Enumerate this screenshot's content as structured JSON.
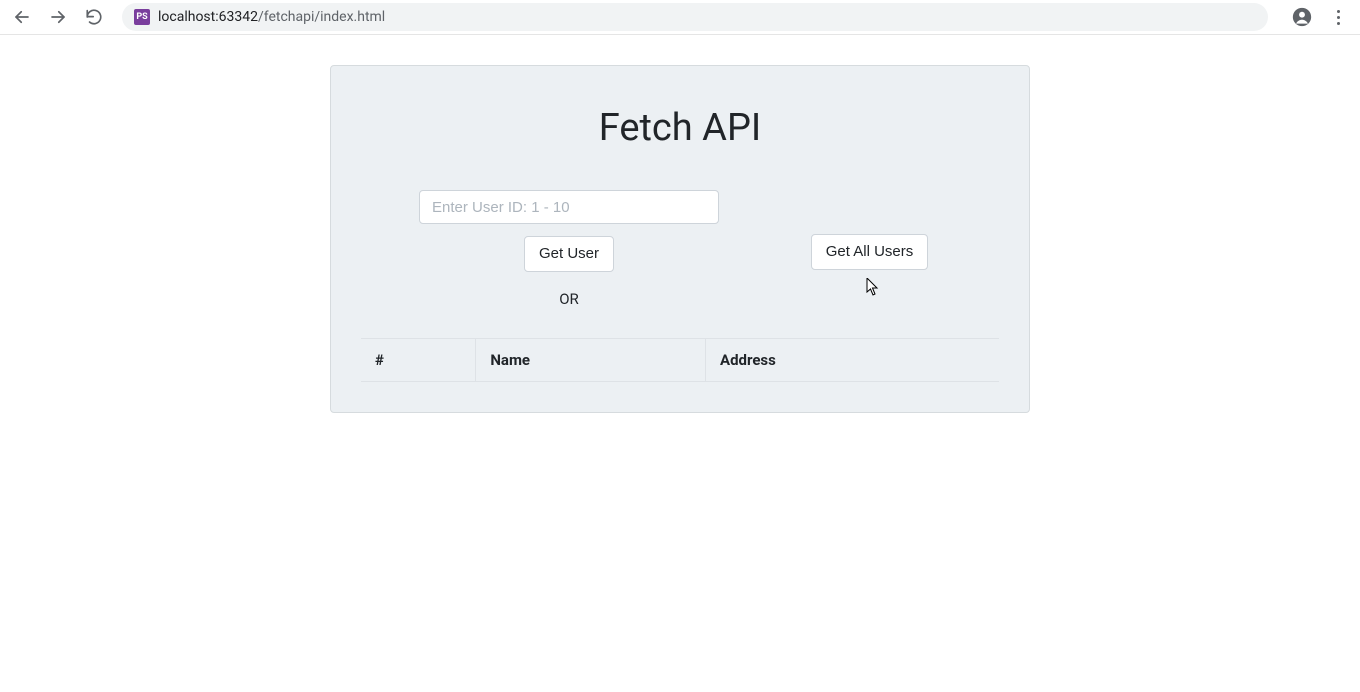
{
  "browser": {
    "url_host": "localhost:63342",
    "url_path": "/fetchapi/index.html",
    "favicon_text": "PS"
  },
  "page": {
    "title": "Fetch API",
    "input_placeholder": "Enter User ID: 1 - 10",
    "input_value": "",
    "get_user_label": "Get User",
    "or_label": "OR",
    "get_all_users_label": "Get All Users"
  },
  "table": {
    "headers": {
      "id": "#",
      "name": "Name",
      "address": "Address"
    },
    "rows": []
  }
}
